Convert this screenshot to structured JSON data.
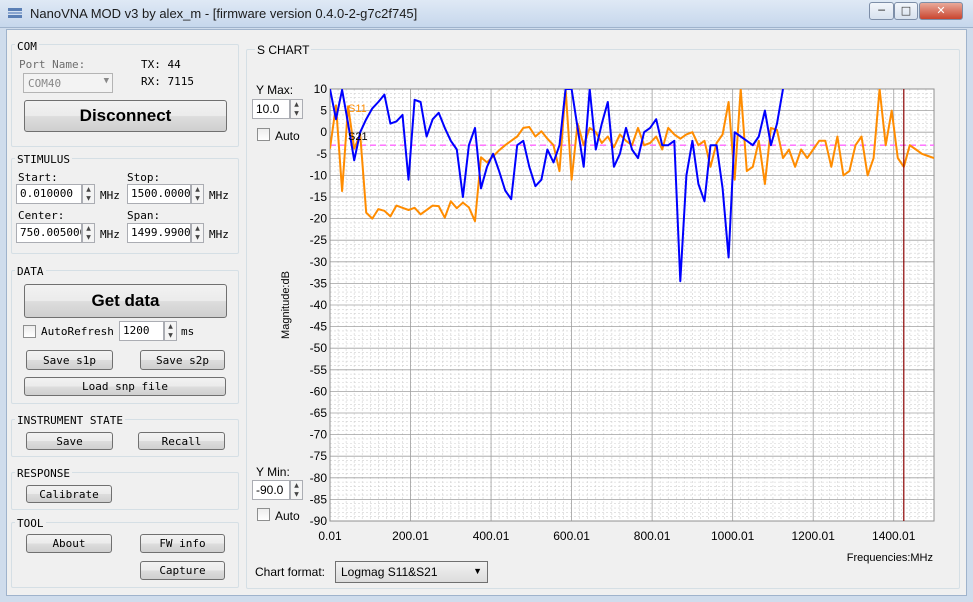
{
  "window": {
    "title": "NanoVNA MOD v3 by alex_m - [firmware version 0.4.0-2-g7c2f745]",
    "minimize": "─",
    "maximize": "□",
    "close": "✕"
  },
  "com": {
    "section": "COM",
    "port_label": "Port Name:",
    "port_value": "COM40",
    "tx": "TX: 44",
    "rx": "RX: 7115",
    "disconnect": "Disconnect"
  },
  "stimulus": {
    "section": "STIMULUS",
    "start_label": "Start:",
    "start_value": "0.010000",
    "stop_label": "Stop:",
    "stop_value": "1500.00000",
    "center_label": "Center:",
    "center_value": "750.005000",
    "span_label": "Span:",
    "span_value": "1499.99000",
    "unit": "MHz"
  },
  "data": {
    "section": "DATA",
    "get_data": "Get data",
    "autorefresh": "AutoRefresh",
    "interval": "1200",
    "interval_unit": "ms",
    "save_s1p": "Save s1p",
    "save_s2p": "Save s2p",
    "load_snp": "Load snp file"
  },
  "instrument": {
    "section": "INSTRUMENT STATE",
    "save": "Save",
    "recall": "Recall"
  },
  "response": {
    "section": "RESPONSE",
    "calibrate": "Calibrate"
  },
  "tool": {
    "section": "TOOL",
    "about": "About",
    "fw_info": "FW info",
    "capture": "Capture"
  },
  "schart": {
    "section": "S CHART",
    "ymax_label": "Y Max:",
    "ymax_value": "10.0",
    "ymin_label": "Y Min:",
    "ymin_value": "-90.0",
    "auto": "Auto",
    "format_label": "Chart format:",
    "format_value": "Logmag S11&S21"
  },
  "colors": {
    "s11": "#ff8c00",
    "s21": "#0000ff",
    "marker": "#8b0000",
    "ref": "#ff66ff"
  },
  "chart_data": {
    "type": "line",
    "xlabel": "Frequencies:MHz",
    "ylabel": "Magnitude:dB",
    "xlim": [
      0.01,
      1500
    ],
    "ylim": [
      -90,
      10
    ],
    "xticks": [
      "0.01",
      "200.01",
      "400.01",
      "600.01",
      "800.01",
      "1000.01",
      "1200.01",
      "1400.01"
    ],
    "xtick_values": [
      0.01,
      200.01,
      400.01,
      600.01,
      800.01,
      1000.01,
      1200.01,
      1400.01
    ],
    "yticks": [
      10,
      5,
      0,
      -5,
      -10,
      -15,
      -20,
      -25,
      -30,
      -35,
      -40,
      -45,
      -50,
      -55,
      -60,
      -65,
      -70,
      -75,
      -80,
      -85,
      -90
    ],
    "grid": true,
    "marker_x": 1425,
    "ref_level": -3,
    "series": [
      {
        "name": "S11",
        "x": [
          0.01,
          15,
          30,
          45,
          60,
          75,
          90,
          105,
          120,
          135,
          150,
          165,
          180,
          195,
          210,
          225,
          240,
          255,
          270,
          285,
          300,
          315,
          330,
          345,
          360,
          375,
          390,
          405,
          420,
          435,
          450,
          465,
          480,
          495,
          510,
          525,
          540,
          555,
          570,
          585,
          600,
          615,
          630,
          645,
          660,
          675,
          690,
          705,
          720,
          735,
          750,
          765,
          780,
          795,
          810,
          825,
          840,
          855,
          870,
          885,
          900,
          915,
          930,
          945,
          960,
          975,
          990,
          1005,
          1020,
          1035,
          1050,
          1065,
          1080,
          1095,
          1110,
          1125,
          1140,
          1155,
          1170,
          1185,
          1200,
          1215,
          1230,
          1245,
          1260,
          1275,
          1290,
          1305,
          1320,
          1335,
          1350,
          1365,
          1380,
          1395,
          1410,
          1425,
          1440,
          1455,
          1470,
          1485,
          1500
        ],
        "values": [
          -3.8,
          6.2,
          -13.6,
          6.0,
          -3.8,
          -0.5,
          -18.6,
          -20.0,
          -17.8,
          -18.2,
          -19.5,
          -17.0,
          -17.5,
          -18.0,
          -17.5,
          -19.0,
          -18.0,
          -17.0,
          -17.1,
          -19.8,
          -16.0,
          -17.6,
          -16.3,
          -17.4,
          -20.6,
          -5.8,
          -7.0,
          -5.6,
          -4.2,
          -3.0,
          -2.0,
          -1.0,
          1.0,
          1.2,
          -1.0,
          0.2,
          -1.5,
          -3.0,
          -9.0,
          10.0,
          -11.0,
          2.0,
          -3.0,
          1.0,
          0.0,
          -2.5,
          -1.0,
          -3.5,
          -0.5,
          -2.0,
          -3.0,
          1.0,
          -3.0,
          -2.5,
          -1.0,
          -4.0,
          1.0,
          -0.5,
          -1.5,
          -0.5,
          0.0,
          -3.0,
          -2.0,
          -8.0,
          -2.5,
          -0.5,
          7.0,
          -11.0,
          10.0,
          -9.0,
          -8.0,
          -2.0,
          -12.0,
          1.0,
          0.5,
          -6.0,
          -4.0,
          -8.0,
          -4.0,
          -6.0,
          -4.0,
          -2.0,
          -2.0,
          -8.0,
          -1.0,
          -10.0,
          -9.0,
          -3.0,
          -1.0,
          -10.0,
          -6.0,
          10.0,
          -3.0,
          5.0,
          -6.0,
          -8.0,
          -3.0,
          -4.0,
          -5.0,
          -5.5,
          -6.0
        ]
      },
      {
        "name": "S21",
        "x": [
          0.01,
          15,
          30,
          45,
          60,
          75,
          90,
          105,
          120,
          135,
          150,
          165,
          180,
          195,
          210,
          225,
          240,
          255,
          270,
          285,
          300,
          315,
          330,
          345,
          360,
          375,
          390,
          405,
          420,
          435,
          450,
          465,
          480,
          495,
          510,
          525,
          540,
          555,
          570,
          585,
          600,
          615,
          630,
          645,
          660,
          675,
          690,
          705,
          720,
          735,
          750,
          765,
          780,
          795,
          810,
          825,
          840,
          855,
          870,
          885,
          900,
          915,
          930,
          945,
          960,
          975,
          990,
          1005,
          1020,
          1035,
          1050,
          1065,
          1080,
          1095,
          1110,
          1125
        ],
        "values": [
          10.0,
          3.0,
          9.8,
          2.0,
          -6.5,
          0.0,
          3.0,
          5.5,
          7.0,
          8.7,
          2.0,
          2.5,
          4.0,
          -11.0,
          7.5,
          7.0,
          -1.0,
          3.0,
          4.5,
          1.0,
          -2.0,
          -4.0,
          -15.0,
          -3.0,
          1.0,
          -13.0,
          -8.0,
          -5.0,
          -9.0,
          -13.5,
          -15.5,
          -3.0,
          -2.0,
          -8.0,
          -12.5,
          -11.0,
          -4.0,
          -7.0,
          -3.0,
          10.0,
          10.0,
          1.0,
          -8.0,
          10.0,
          -4.0,
          2.0,
          7.0,
          -8.0,
          -5.0,
          1.0,
          -4.0,
          -6.0,
          0.0,
          1.0,
          3.0,
          -3.0,
          -3.0,
          -2.0,
          -34.5,
          -10.0,
          -2.0,
          -12.0,
          -16.0,
          -3.0,
          -3.0,
          -13.0,
          -29.0,
          0.0,
          -1.0,
          -2.0,
          -3.0,
          -1.0,
          5.0,
          -3.0,
          2.0,
          10.0
        ]
      }
    ]
  }
}
